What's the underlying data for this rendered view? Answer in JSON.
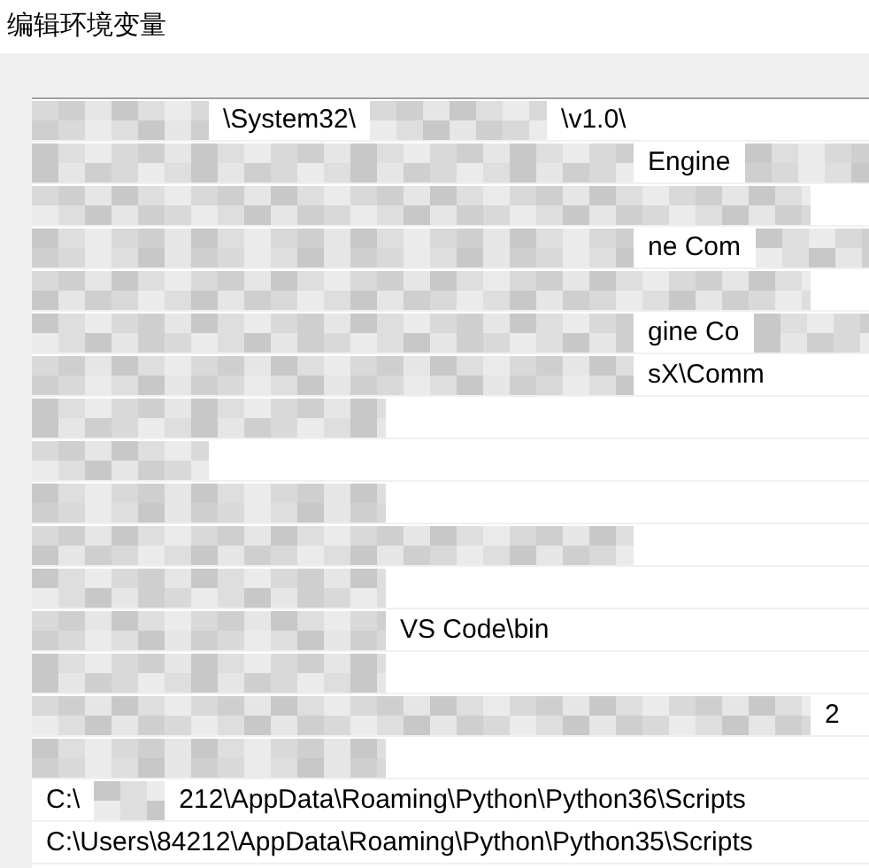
{
  "window": {
    "title": "编辑环境变量"
  },
  "rows": [
    {
      "segments": [
        {
          "kind": "mosaic-s"
        },
        {
          "kind": "text",
          "text": "\\System32\\"
        },
        {
          "kind": "mosaic-s"
        },
        {
          "kind": "text",
          "text": "\\v1.0\\"
        }
      ]
    },
    {
      "segments": [
        {
          "kind": "mosaic-l"
        },
        {
          "kind": "text",
          "text": "Engine"
        },
        {
          "kind": "mosaic-s"
        }
      ]
    },
    {
      "segments": [
        {
          "kind": "mosaic-xl"
        }
      ]
    },
    {
      "segments": [
        {
          "kind": "mosaic-l"
        },
        {
          "kind": "text",
          "text": "ne Com"
        },
        {
          "kind": "mosaic-s"
        }
      ]
    },
    {
      "segments": [
        {
          "kind": "mosaic-xl"
        }
      ]
    },
    {
      "segments": [
        {
          "kind": "mosaic-l"
        },
        {
          "kind": "text",
          "text": "gine Co"
        },
        {
          "kind": "mosaic-s"
        }
      ]
    },
    {
      "segments": [
        {
          "kind": "mosaic-l"
        },
        {
          "kind": "text",
          "text": "sX\\Comm"
        }
      ]
    },
    {
      "segments": [
        {
          "kind": "mosaic-m"
        }
      ]
    },
    {
      "segments": [
        {
          "kind": "mosaic-s"
        }
      ]
    },
    {
      "segments": [
        {
          "kind": "mosaic-m"
        }
      ]
    },
    {
      "segments": [
        {
          "kind": "mosaic-l"
        }
      ]
    },
    {
      "segments": [
        {
          "kind": "mosaic-m"
        }
      ]
    },
    {
      "segments": [
        {
          "kind": "mosaic-m"
        },
        {
          "kind": "text",
          "text": "VS Code\\bin"
        }
      ]
    },
    {
      "segments": [
        {
          "kind": "mosaic-m"
        }
      ]
    },
    {
      "segments": [
        {
          "kind": "mosaic-xl"
        },
        {
          "kind": "text",
          "text": "2"
        }
      ]
    },
    {
      "segments": [
        {
          "kind": "mosaic-m"
        }
      ]
    },
    {
      "segments": [
        {
          "kind": "text",
          "text": "C:\\"
        },
        {
          "kind": "mosaic-xs"
        },
        {
          "kind": "text",
          "text": "212\\AppData\\Roaming\\Python\\Python36\\Scripts"
        }
      ]
    },
    {
      "segments": [
        {
          "kind": "text",
          "text": "C:\\Users\\84212\\AppData\\Roaming\\Python\\Python35\\Scripts"
        }
      ]
    }
  ]
}
